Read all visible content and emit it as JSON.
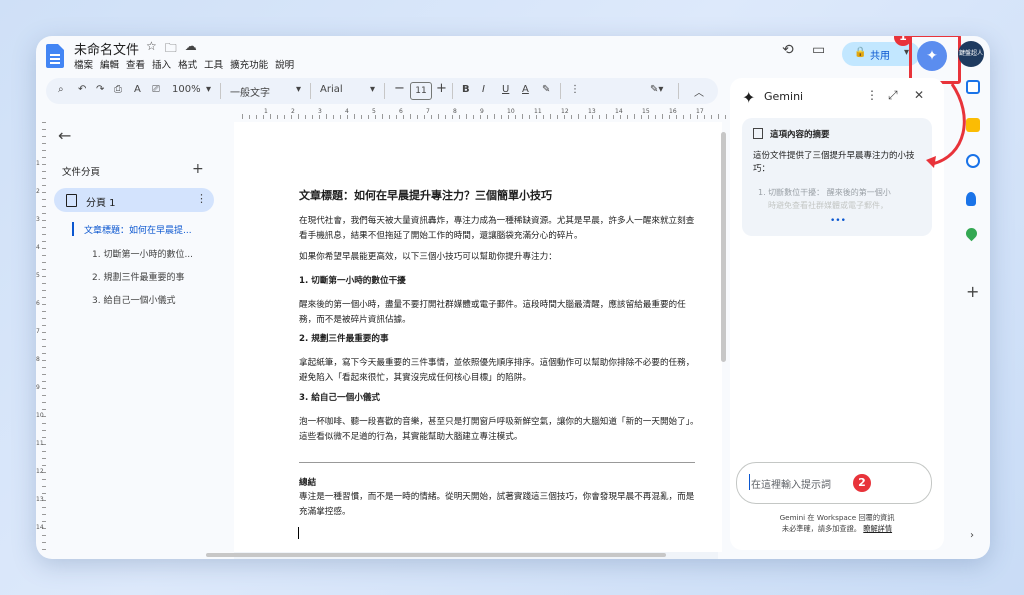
{
  "doc": {
    "title": "未命名文件",
    "menu": [
      "檔案",
      "編輯",
      "查看",
      "插入",
      "格式",
      "工具",
      "擴充功能",
      "說明"
    ]
  },
  "header": {
    "share_label": "共用",
    "avatar_text": "鍵盤超人",
    "gemini_badge": "1"
  },
  "toolbar": {
    "zoom": "100%",
    "style": "一般文字",
    "font": "Arial",
    "font_size": "11",
    "text_color_icon": "A"
  },
  "ruler": {
    "h_numbers": [
      "1",
      "2",
      "3",
      "4",
      "5",
      "6",
      "7",
      "8",
      "9",
      "10",
      "11",
      "12",
      "13",
      "14",
      "15",
      "16",
      "17"
    ],
    "v_numbers": [
      "1",
      "2",
      "3",
      "4",
      "5",
      "6",
      "7",
      "8",
      "9",
      "10",
      "11",
      "12",
      "13",
      "14"
    ]
  },
  "outline": {
    "header": "文件分頁",
    "tab_label": "分頁 1",
    "items": [
      "文章標題：如何在早晨提...",
      "1. 切斷第一小時的數位...",
      "2. 規劃三件最重要的事",
      "3. 給自己一個小儀式"
    ]
  },
  "page": {
    "title": "文章標題：如何在早晨提升專注力？三個簡單小技巧",
    "p1": "在現代社會，我們每天被大量資訊轟炸，專注力成為一種稀缺資源。尤其是早晨，許多人一醒來就立刻查看手機訊息，結果不但拖延了開始工作的時間，還讓腦袋充滿分心的碎片。",
    "p2": "如果你希望早晨能更高效，以下三個小技巧可以幫助你提升專注力：",
    "h1": "1. 切斷第一小時的數位干擾",
    "p3": "醒來後的第一個小時，盡量不要打開社群媒體或電子郵件。這段時間大腦最清醒，應該留給最重要的任務，而不是被碎片資訊佔據。",
    "h2": "2. 規劃三件最重要的事",
    "p4": "拿起紙筆，寫下今天最重要的三件事情，並依照優先順序排序。這個動作可以幫助你排除不必要的任務，避免陷入「看起來很忙，其實沒完成任何核心目標」的陷阱。",
    "h3": "3. 給自己一個小儀式",
    "p5": "泡一杯咖啡、聽一段喜歡的音樂，甚至只是打開窗戶呼吸新鮮空氣，讓你的大腦知道「新的一天開始了」。這些看似微不足道的行為，其實能幫助大腦建立專注模式。",
    "h4": "總結",
    "p6": "專注是一種習慣，而不是一時的情緒。從明天開始，試著實踐這三個技巧，你會發現早晨不再混亂，而是充滿掌控感。"
  },
  "gemini": {
    "title": "Gemini",
    "summary_header": "這項內容的摘要",
    "summary_body": "這份文件提供了三個提升早晨專注力的小技巧：",
    "summary_li": "1.  切斷數位干擾： 醒來後的第一個小",
    "summary_li2": "時避免查看社群媒體或電子郵件，",
    "input_placeholder": "在這裡輸入提示詞",
    "input_badge": "2",
    "disclaimer_1": "Gemini 在 Workspace 回覆的資訊",
    "disclaimer_2": "未必準確，請多加查證。",
    "disclaimer_link": "瞭解詳情"
  },
  "colors": {
    "accent": "#0b57d0",
    "badge_red": "#e8333a",
    "share_bg": "#c2e7ff"
  }
}
